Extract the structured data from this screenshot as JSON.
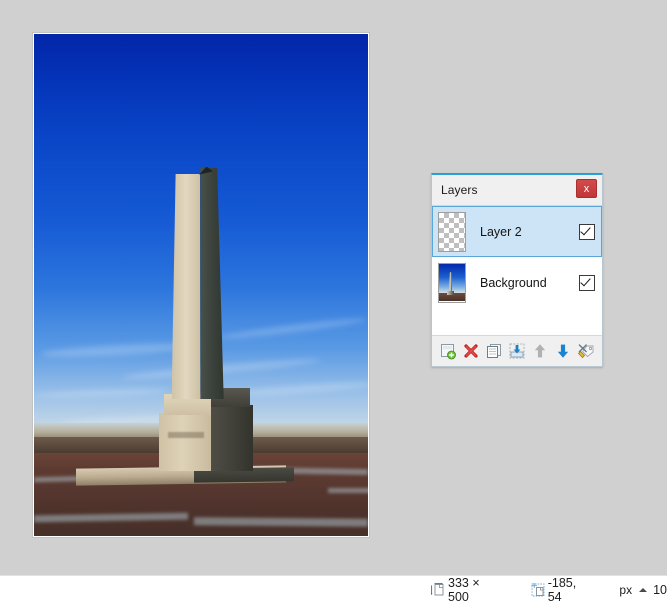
{
  "panel": {
    "title": "Layers",
    "close_label": "x",
    "layers": [
      {
        "name": "Layer 2",
        "thumb": "transparent-checkerboard",
        "visible": true,
        "selected": true
      },
      {
        "name": "Background",
        "thumb": "obelisk-photo",
        "visible": false,
        "selected": false
      }
    ],
    "toolbar": [
      {
        "name": "add-layer",
        "title": "Add New Layer"
      },
      {
        "name": "delete-layer",
        "title": "Delete Layer"
      },
      {
        "name": "duplicate-layer",
        "title": "Duplicate Layer"
      },
      {
        "name": "merge-layer-down",
        "title": "Merge Layer Down"
      },
      {
        "name": "move-layer-up",
        "title": "Move Layer Up"
      },
      {
        "name": "move-layer-down",
        "title": "Move Layer Down"
      },
      {
        "name": "layer-properties",
        "title": "Layer Properties"
      }
    ]
  },
  "status_bar": {
    "image_size": "333 × 500",
    "cursor_position": "-185, 54",
    "unit": "px",
    "zoom": "10"
  },
  "canvas": {
    "image_title": "obelisk-photo"
  },
  "colors": {
    "accent": "#2a9fd6",
    "selection": "#cde4f7",
    "close_button": "#c03737",
    "app_background": "#d0d0d0",
    "panel_background": "#ffffff"
  }
}
